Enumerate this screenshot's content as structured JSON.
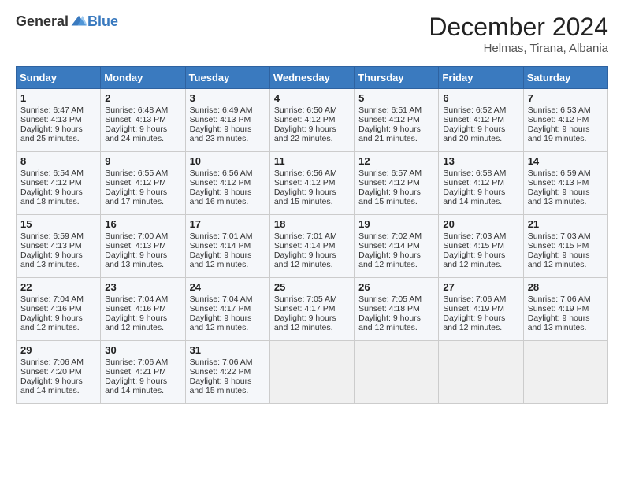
{
  "logo": {
    "general": "General",
    "blue": "Blue"
  },
  "header": {
    "month_title": "December 2024",
    "location": "Helmas, Tirana, Albania"
  },
  "weekdays": [
    "Sunday",
    "Monday",
    "Tuesday",
    "Wednesday",
    "Thursday",
    "Friday",
    "Saturday"
  ],
  "weeks": [
    [
      {
        "day": 1,
        "sunrise": "6:47 AM",
        "sunset": "4:13 PM",
        "daylight": "9 hours and 25 minutes."
      },
      {
        "day": 2,
        "sunrise": "6:48 AM",
        "sunset": "4:13 PM",
        "daylight": "9 hours and 24 minutes."
      },
      {
        "day": 3,
        "sunrise": "6:49 AM",
        "sunset": "4:13 PM",
        "daylight": "9 hours and 23 minutes."
      },
      {
        "day": 4,
        "sunrise": "6:50 AM",
        "sunset": "4:12 PM",
        "daylight": "9 hours and 22 minutes."
      },
      {
        "day": 5,
        "sunrise": "6:51 AM",
        "sunset": "4:12 PM",
        "daylight": "9 hours and 21 minutes."
      },
      {
        "day": 6,
        "sunrise": "6:52 AM",
        "sunset": "4:12 PM",
        "daylight": "9 hours and 20 minutes."
      },
      {
        "day": 7,
        "sunrise": "6:53 AM",
        "sunset": "4:12 PM",
        "daylight": "9 hours and 19 minutes."
      }
    ],
    [
      {
        "day": 8,
        "sunrise": "6:54 AM",
        "sunset": "4:12 PM",
        "daylight": "9 hours and 18 minutes."
      },
      {
        "day": 9,
        "sunrise": "6:55 AM",
        "sunset": "4:12 PM",
        "daylight": "9 hours and 17 minutes."
      },
      {
        "day": 10,
        "sunrise": "6:56 AM",
        "sunset": "4:12 PM",
        "daylight": "9 hours and 16 minutes."
      },
      {
        "day": 11,
        "sunrise": "6:56 AM",
        "sunset": "4:12 PM",
        "daylight": "9 hours and 15 minutes."
      },
      {
        "day": 12,
        "sunrise": "6:57 AM",
        "sunset": "4:12 PM",
        "daylight": "9 hours and 15 minutes."
      },
      {
        "day": 13,
        "sunrise": "6:58 AM",
        "sunset": "4:12 PM",
        "daylight": "9 hours and 14 minutes."
      },
      {
        "day": 14,
        "sunrise": "6:59 AM",
        "sunset": "4:13 PM",
        "daylight": "9 hours and 13 minutes."
      }
    ],
    [
      {
        "day": 15,
        "sunrise": "6:59 AM",
        "sunset": "4:13 PM",
        "daylight": "9 hours and 13 minutes."
      },
      {
        "day": 16,
        "sunrise": "7:00 AM",
        "sunset": "4:13 PM",
        "daylight": "9 hours and 13 minutes."
      },
      {
        "day": 17,
        "sunrise": "7:01 AM",
        "sunset": "4:14 PM",
        "daylight": "9 hours and 12 minutes."
      },
      {
        "day": 18,
        "sunrise": "7:01 AM",
        "sunset": "4:14 PM",
        "daylight": "9 hours and 12 minutes."
      },
      {
        "day": 19,
        "sunrise": "7:02 AM",
        "sunset": "4:14 PM",
        "daylight": "9 hours and 12 minutes."
      },
      {
        "day": 20,
        "sunrise": "7:03 AM",
        "sunset": "4:15 PM",
        "daylight": "9 hours and 12 minutes."
      },
      {
        "day": 21,
        "sunrise": "7:03 AM",
        "sunset": "4:15 PM",
        "daylight": "9 hours and 12 minutes."
      }
    ],
    [
      {
        "day": 22,
        "sunrise": "7:04 AM",
        "sunset": "4:16 PM",
        "daylight": "9 hours and 12 minutes."
      },
      {
        "day": 23,
        "sunrise": "7:04 AM",
        "sunset": "4:16 PM",
        "daylight": "9 hours and 12 minutes."
      },
      {
        "day": 24,
        "sunrise": "7:04 AM",
        "sunset": "4:17 PM",
        "daylight": "9 hours and 12 minutes."
      },
      {
        "day": 25,
        "sunrise": "7:05 AM",
        "sunset": "4:17 PM",
        "daylight": "9 hours and 12 minutes."
      },
      {
        "day": 26,
        "sunrise": "7:05 AM",
        "sunset": "4:18 PM",
        "daylight": "9 hours and 12 minutes."
      },
      {
        "day": 27,
        "sunrise": "7:06 AM",
        "sunset": "4:19 PM",
        "daylight": "9 hours and 12 minutes."
      },
      {
        "day": 28,
        "sunrise": "7:06 AM",
        "sunset": "4:19 PM",
        "daylight": "9 hours and 13 minutes."
      }
    ],
    [
      {
        "day": 29,
        "sunrise": "7:06 AM",
        "sunset": "4:20 PM",
        "daylight": "9 hours and 14 minutes."
      },
      {
        "day": 30,
        "sunrise": "7:06 AM",
        "sunset": "4:21 PM",
        "daylight": "9 hours and 14 minutes."
      },
      {
        "day": 31,
        "sunrise": "7:06 AM",
        "sunset": "4:22 PM",
        "daylight": "9 hours and 15 minutes."
      },
      null,
      null,
      null,
      null
    ]
  ],
  "cell_labels": {
    "sunrise": "Sunrise:",
    "sunset": "Sunset:",
    "daylight": "Daylight:"
  }
}
